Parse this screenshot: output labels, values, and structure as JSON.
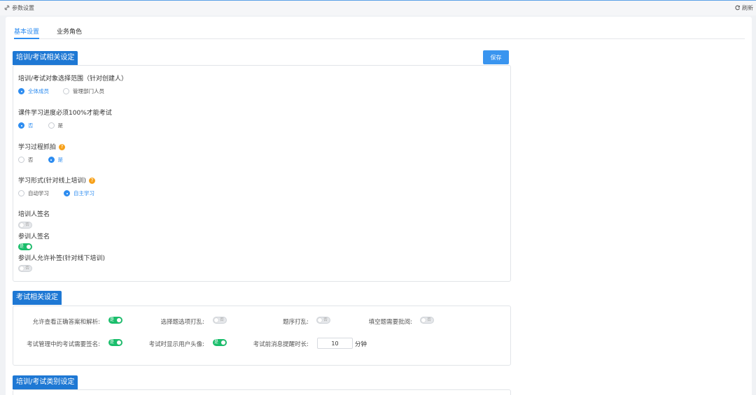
{
  "header": {
    "title": "参数设置",
    "refresh_label": "刷新"
  },
  "tabs": [
    {
      "label": "基本设置",
      "active": true
    },
    {
      "label": "业务角色",
      "active": false
    }
  ],
  "section1": {
    "title": "培训/考试相关设定",
    "save_label": "保存",
    "q1": {
      "label": "培训/考试对象选择范围（针对创建人）",
      "options": [
        "全体成员",
        "管理部门人员"
      ],
      "selected": 0
    },
    "q2": {
      "label": "课件学习进度必须100%才能考试",
      "options": [
        "否",
        "是"
      ],
      "selected": 0
    },
    "q3": {
      "label": "学习过程抓拍",
      "options": [
        "否",
        "是"
      ],
      "selected": 1
    },
    "q4": {
      "label": "学习形式(针对线上培训)",
      "options": [
        "自动学习",
        "自主学习"
      ],
      "selected": 1
    },
    "sw1": {
      "label": "培训人签名",
      "on": false,
      "text_off": "否"
    },
    "sw2": {
      "label": "参训人签名",
      "on": true,
      "text_on": "是"
    },
    "sw3": {
      "label": "参训人允许补签(针对线下培训)",
      "on": false,
      "text_off": "否"
    }
  },
  "section2": {
    "title": "考试相关设定",
    "items": [
      {
        "label": "允许查看正确答案和解析:",
        "on": true,
        "text": "是"
      },
      {
        "label": "选择题选项打乱:",
        "on": false,
        "text": "否"
      },
      {
        "label": "题序打乱:",
        "on": false,
        "text": "否"
      },
      {
        "label": "填空题需要批阅:",
        "on": false,
        "text": "否"
      },
      {
        "label": "考试管理中的考试需要签名:",
        "on": true,
        "text": "是"
      },
      {
        "label": "考试时显示用户头像:",
        "on": true,
        "text": "是"
      }
    ],
    "reminder_label": "考试前消息提醒时长:",
    "reminder_value": "10",
    "reminder_unit": "分钟"
  },
  "section3": {
    "title": "培训/考试类别设定"
  },
  "colors": {
    "accent": "#2d8cf0",
    "section_bg": "#1e78d4",
    "switch_on": "#19be6b",
    "help_icon": "#f7a11a"
  }
}
